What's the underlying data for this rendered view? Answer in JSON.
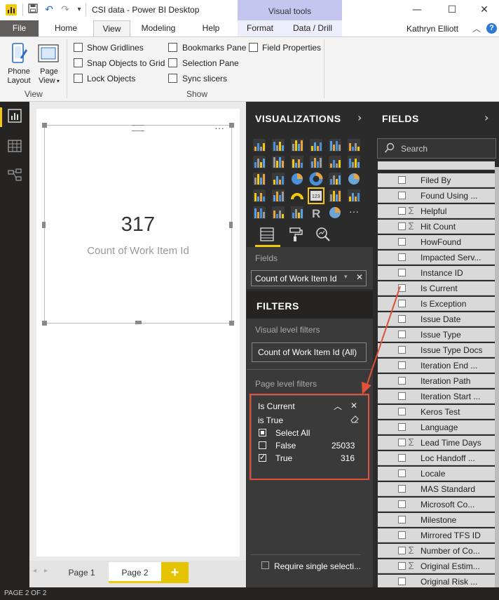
{
  "window": {
    "title": "CSI data - Power BI Desktop",
    "context_tab": "Visual tools",
    "minimize": "—",
    "maximize": "☐",
    "close": "✕"
  },
  "tabs": {
    "file": "File",
    "home": "Home",
    "view": "View",
    "modeling": "Modeling",
    "help": "Help",
    "format": "Format",
    "data_drill": "Data / Drill"
  },
  "user": {
    "name": "Kathryn Elliott",
    "help": "?"
  },
  "ribbon": {
    "phone_layout": "Phone Layout",
    "page_view": "Page View",
    "view_group": "View",
    "show_group": "Show",
    "checkboxes": [
      "Show Gridlines",
      "Snap Objects to Grid",
      "Lock Objects",
      "Bookmarks Pane",
      "Selection Pane",
      "Sync slicers",
      "Field Properties"
    ]
  },
  "card": {
    "value": "317",
    "label": "Count of Work Item Id",
    "more": "···"
  },
  "pages": {
    "page1": "Page 1",
    "page2": "Page 2",
    "add": "+"
  },
  "status": {
    "text": "PAGE 2 OF 2"
  },
  "viz": {
    "header": "VISUALIZATIONS",
    "fields_label": "Fields",
    "field_well": "Count of Work Item Id",
    "ellipsis": "···"
  },
  "filters": {
    "header": "FILTERS",
    "visual_level": "Visual level filters",
    "visual_filter": "Count of Work Item Id  (All)",
    "page_level": "Page level filters",
    "card": {
      "title": "Is Current",
      "condition": "is True",
      "select_all": "Select All",
      "options": [
        {
          "label": "False",
          "count": "25033",
          "checked": false
        },
        {
          "label": "True",
          "count": "316",
          "checked": true
        }
      ]
    },
    "require_single": "Require single selecti..."
  },
  "fields": {
    "header": "FIELDS",
    "search_placeholder": "Search",
    "items": [
      {
        "name": "Filed By",
        "sigma": false
      },
      {
        "name": "Found Using ...",
        "sigma": false
      },
      {
        "name": "Helpful",
        "sigma": true
      },
      {
        "name": "Hit Count",
        "sigma": true
      },
      {
        "name": "HowFound",
        "sigma": false
      },
      {
        "name": "Impacted Serv...",
        "sigma": false
      },
      {
        "name": "Instance ID",
        "sigma": false
      },
      {
        "name": "Is Current",
        "sigma": false
      },
      {
        "name": "Is Exception",
        "sigma": false
      },
      {
        "name": "Issue Date",
        "sigma": false
      },
      {
        "name": "Issue Type",
        "sigma": false
      },
      {
        "name": "Issue Type Docs",
        "sigma": false
      },
      {
        "name": "Iteration End ...",
        "sigma": false
      },
      {
        "name": "Iteration Path",
        "sigma": false
      },
      {
        "name": "Iteration Start ...",
        "sigma": false
      },
      {
        "name": "Keros Test",
        "sigma": false
      },
      {
        "name": "Language",
        "sigma": false
      },
      {
        "name": "Lead Time Days",
        "sigma": true
      },
      {
        "name": "Loc Handoff ...",
        "sigma": false
      },
      {
        "name": "Locale",
        "sigma": false
      },
      {
        "name": "MAS Standard",
        "sigma": false
      },
      {
        "name": "Microsoft Co...",
        "sigma": false
      },
      {
        "name": "Milestone",
        "sigma": false
      },
      {
        "name": "Mirrored TFS ID",
        "sigma": false
      },
      {
        "name": "Number of Co...",
        "sigma": true
      },
      {
        "name": "Original Estim...",
        "sigma": true
      },
      {
        "name": "Original Risk ...",
        "sigma": false
      }
    ]
  },
  "colors": {
    "accent_yellow": "#f2c811",
    "visual_tools": "#c5c6f0",
    "highlight_red": "#e0503a",
    "pane_dark": "#2b2b2b"
  }
}
